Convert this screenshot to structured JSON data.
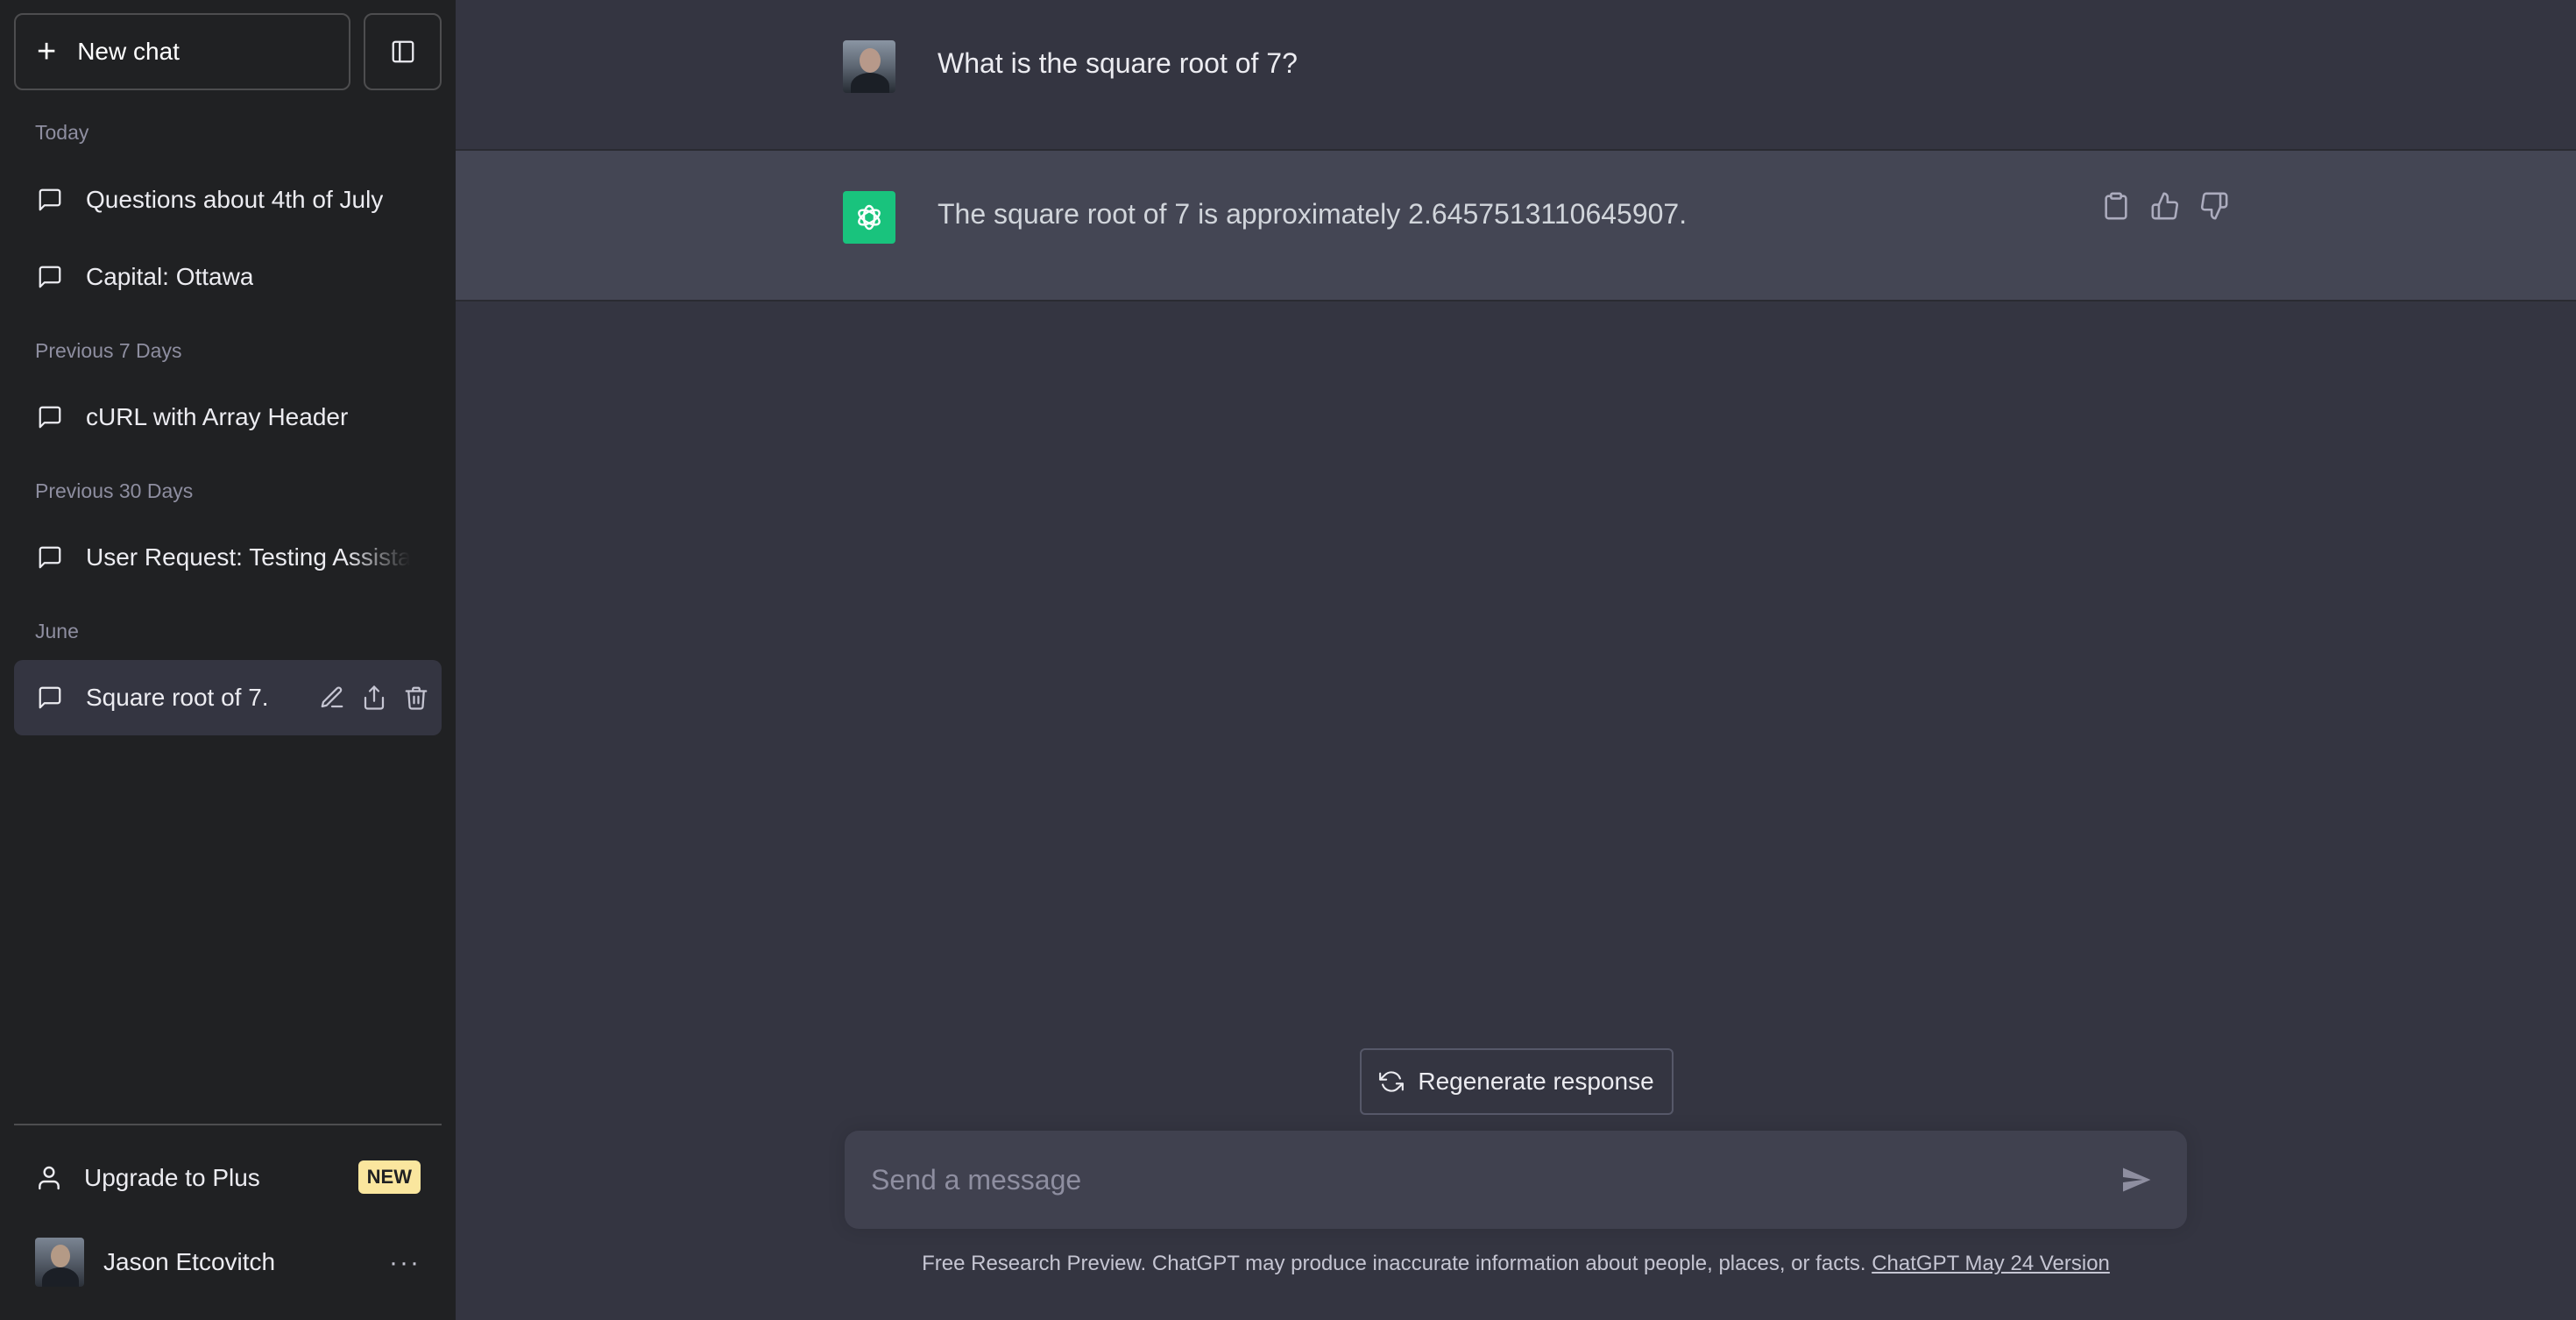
{
  "sidebar": {
    "new_chat_label": "New chat",
    "sections": [
      {
        "title": "Today"
      },
      {
        "title": "Previous 7 Days"
      },
      {
        "title": "Previous 30 Days"
      },
      {
        "title": "June"
      }
    ],
    "chats": [
      {
        "label": "Questions about 4th of July"
      },
      {
        "label": "Capital: Ottawa"
      },
      {
        "label": "cURL with Array Header"
      },
      {
        "label": "User Request: Testing Assistant"
      },
      {
        "label": "Square root of 7."
      }
    ],
    "upgrade_label": "Upgrade to Plus",
    "upgrade_badge": "NEW",
    "user_name": "Jason Etcovitch",
    "user_more": "···"
  },
  "conversation": {
    "user_message": "What is the square root of 7?",
    "assistant_message": "The square root of 7 is approximately 2.6457513110645907."
  },
  "regenerate_label": "Regenerate response",
  "composer": {
    "placeholder": "Send a message",
    "value": ""
  },
  "footer": {
    "text": "Free Research Preview. ChatGPT may produce inaccurate information about people, places, or facts. ",
    "link": "ChatGPT May 24 Version"
  },
  "colors": {
    "sidebar_bg": "#202123",
    "main_bg": "#343541",
    "assistant_bg": "#444654",
    "brand_green": "#19c37d",
    "badge_yellow": "#fae69e"
  },
  "icons": [
    "plus-icon",
    "sidebar-toggle-icon",
    "chat-bubble-icon",
    "pencil-icon",
    "share-icon",
    "trash-icon",
    "user-icon",
    "openai-logo-icon",
    "clipboard-icon",
    "thumbs-up-icon",
    "thumbs-down-icon",
    "refresh-icon",
    "send-icon",
    "more-icon"
  ]
}
